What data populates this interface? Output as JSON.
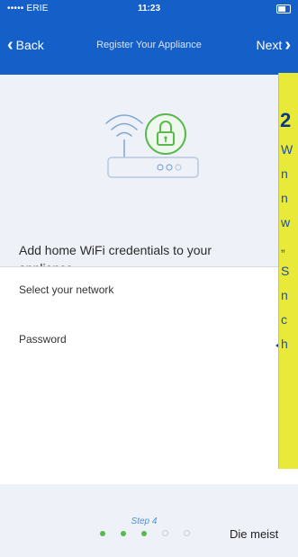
{
  "status_bar": {
    "carrier": "••••• ERIE",
    "time": "11:23"
  },
  "nav": {
    "back_label": "Back",
    "title": "Register Your Appliance",
    "next_label": "Next"
  },
  "instruction": "Add home WiFi credentials to your appliance",
  "fields": {
    "network_placeholder": "Select your network",
    "password_placeholder": "Password"
  },
  "note": {
    "number": "2",
    "letters": [
      "W",
      "n",
      "n",
      "w",
      "„",
      "S",
      "n",
      "c",
      "h"
    ]
  },
  "footer": {
    "step_label": "Step 4",
    "overlay_text": "Die meist",
    "steps_completed": 3,
    "steps_total": 5
  },
  "colors": {
    "nav_bg": "#1560c8",
    "accent_green": "#59b94f",
    "note_yellow": "#e9e93a"
  },
  "icons": [
    "wifi-icon",
    "router-icon",
    "lock-icon",
    "chevron-left-icon",
    "chevron-right-icon"
  ]
}
